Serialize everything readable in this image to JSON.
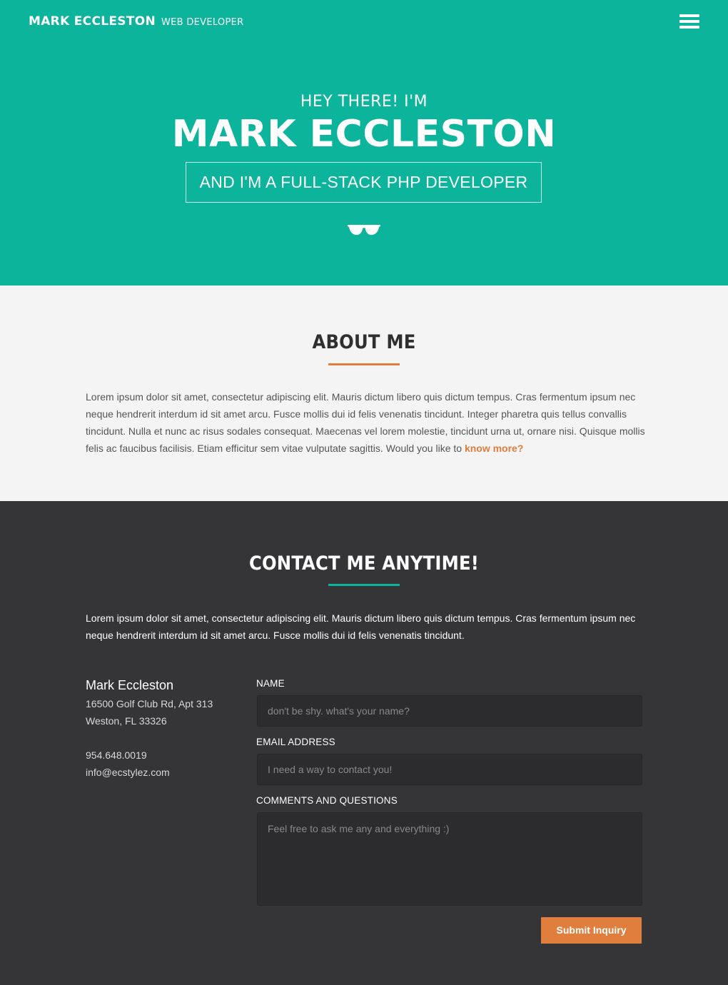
{
  "nav": {
    "brand_name": "MARK ECCLESTON",
    "brand_role": "WEB DEVELOPER",
    "menu_icon": "hamburger-menu-icon"
  },
  "hero": {
    "greeting": "HEY THERE! I'M",
    "name": "MARK ECCLESTON",
    "tagline": "AND I'M A FULL-STACK PHP DEVELOPER",
    "icon": "sunglasses-icon"
  },
  "about": {
    "title": "ABOUT ME",
    "text": "Lorem ipsum dolor sit amet, consectetur adipiscing elit. Mauris dictum libero quis dictum tempus. Cras fermentum ipsum nec neque hendrerit interdum id sit amet arcu. Fusce mollis dui id felis venenatis tincidunt. Integer pharetra quis tellus convallis tincidunt. Nulla et nunc ac risus sodales consequat. Maecenas vel lorem molestie, tincidunt urna ut, ornare nisi. Quisque mollis felis ac faucibus facilisis. Etiam efficitur sem vitae vulputate sagittis.  Would you like to ",
    "link": "know more?"
  },
  "contact": {
    "title": "CONTACT ME ANYTIME!",
    "intro": "Lorem ipsum dolor sit amet, consectetur adipiscing elit. Mauris dictum libero quis dictum tempus. Cras fermentum ipsum nec neque hendrerit interdum id sit amet arcu. Fusce mollis dui id felis venenatis tincidunt.",
    "card": {
      "name": "Mark Eccleston",
      "address1": "16500 Golf Club Rd, Apt 313",
      "address2": "Weston, FL 33326",
      "phone": "954.648.0019",
      "email": "info@ecstylez.com"
    },
    "form": {
      "name_label": "NAME",
      "name_placeholder": "don't be shy. what's your name?",
      "email_label": "EMAIL ADDRESS",
      "email_placeholder": "I need a way to contact you!",
      "comments_label": "COMMENTS AND QUESTIONS",
      "comments_placeholder": "Feel free to ask me any and everything :)",
      "submit_label": "Submit Inquiry"
    }
  },
  "colors": {
    "teal": "#0cb49c",
    "orange": "#e07e3e",
    "dark": "#353537",
    "light": "#f4f4f4"
  }
}
